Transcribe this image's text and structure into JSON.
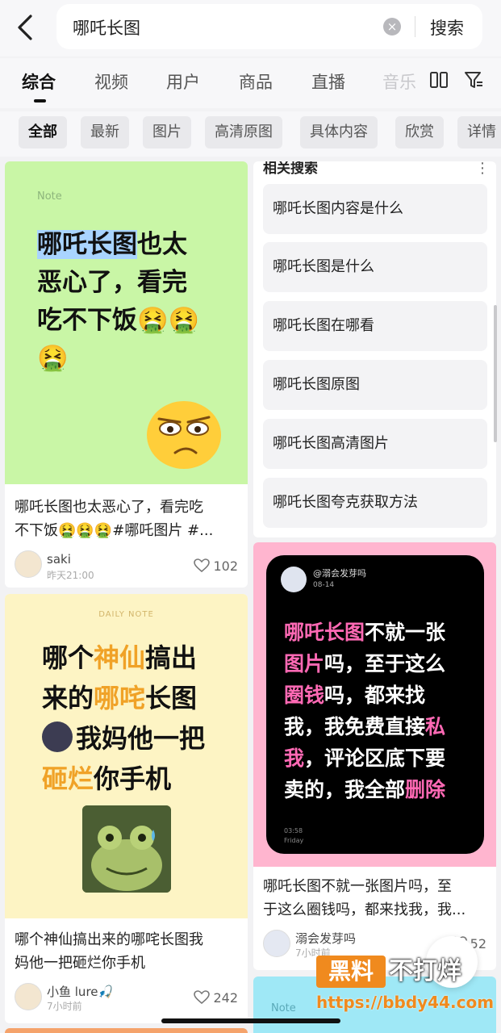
{
  "search": {
    "query": "哪吒长图",
    "submit_label": "搜索"
  },
  "tabs": [
    "综合",
    "视频",
    "用户",
    "商品",
    "直播",
    "音乐"
  ],
  "chips": [
    "全部",
    "最新",
    "图片",
    "高清原图",
    "具体内容",
    "欣赏",
    "详情"
  ],
  "notes": [
    {
      "image_label": "Note",
      "image_text_hl": "哪吒长图",
      "image_text_rest": "也太\n恶心了，看完\n吃不下饭🤮🤮\n🤮",
      "title": "哪吒长图也太恶心了，看完吃\n不下饭🤮🤮🤮#哪吒图片 #...",
      "author": "saki",
      "time": "昨天21:00",
      "likes": "102"
    },
    {
      "image_label": "DAILY NOTE",
      "title": "哪个神仙搞出来的哪咤长图我\n妈他一把砸烂你手机",
      "author": "小鱼 lure🎣",
      "time": "7小时前",
      "likes": "242"
    },
    {
      "phone_name": "@溺会发芽吗",
      "phone_date": "08-14",
      "phone_time": "03:58",
      "phone_day": "Friday",
      "title": "哪吒长图不就一张图片吗，至\n于这么圈钱吗，都来找我，我...",
      "author": "溺会发芽吗",
      "time": "7小时前",
      "likes": "52"
    }
  ],
  "note2_lines": {
    "l1a": "哪个",
    "l1b": "神仙",
    "l1c": "搞出",
    "l2a": "来的",
    "l2b": "哪咤",
    "l2c": "长图",
    "l3": "我妈他一把",
    "l4a": "砸烂",
    "l4b": "你手机"
  },
  "note3_lines": {
    "l1a": "哪吒长图",
    "l1b": "不就一张",
    "l2a": "图片",
    "l2b": "吗，至于这么",
    "l3a": "圈钱",
    "l3b": "吗，都来找",
    "l4a": "我，我免费直接",
    "l4b": "私",
    "l5a": "我",
    "l5b": "，评论区底下要",
    "l6a": "卖的，我全部",
    "l6b": "删除"
  },
  "related": {
    "title": "相关搜索",
    "items": [
      "哪吒长图内容是什么",
      "哪吒长图是什么",
      "哪吒长图在哪看",
      "哪吒长图原图",
      "哪吒长图高清图片",
      "哪吒长图夸克获取方法"
    ]
  },
  "next_card_label": "Note",
  "watermark": {
    "brand_a": "黑料",
    "brand_b": "不打烊",
    "url": "https://bbdy44.com"
  },
  "colors": {
    "note1_bg": "#c9f6a6",
    "note2_bg": "#fdf4c4",
    "note3_bg": "#ffb5cf",
    "note4_bg": "#9fe8f6",
    "highlight_blue": "#a9d4ff",
    "accent_orange": "#f0a227",
    "accent_pink": "#ff69b4"
  }
}
